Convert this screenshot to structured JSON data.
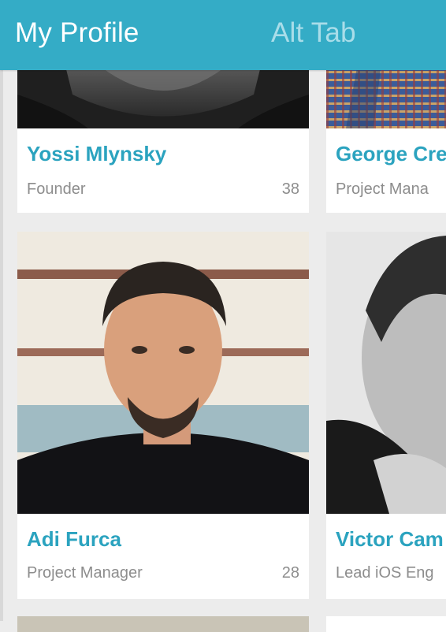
{
  "header": {
    "tabs": [
      {
        "label": "My Profile",
        "active": true
      },
      {
        "label": "Alt Tab",
        "active": false
      }
    ],
    "color": "#34acc6"
  },
  "people": [
    {
      "name": "Yossi Mlynsky",
      "role": "Founder",
      "count": "38"
    },
    {
      "name": "George Cre",
      "role": "Project Mana"
    },
    {
      "name": "Adi Furca",
      "role": "Project Manager",
      "count": "28"
    },
    {
      "name": "Victor Cam",
      "role": "Lead iOS Eng"
    }
  ],
  "colors": {
    "accent": "#2ba3bf",
    "secondary_text": "#8d8d8d",
    "background": "#ececec"
  }
}
